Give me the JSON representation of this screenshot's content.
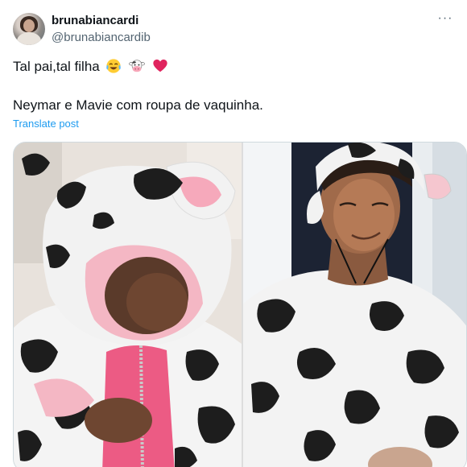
{
  "post": {
    "author": {
      "display_name": "brunabiancardi",
      "handle": "@brunabiancardib",
      "avatar_icon": "profile-photo"
    },
    "more_icon": "more-horizontal-icon",
    "more_glyph": "···",
    "text_line1": "Tal pai,tal filha",
    "text_line1_emojis": [
      "face-with-tears-of-joy-emoji",
      "cow-face-emoji",
      "red-heart-emoji"
    ],
    "text_line2": "Neymar e Mavie com roupa de vaquinha.",
    "translate_label": "Translate post"
  },
  "media": {
    "photos": [
      {
        "subject": "baby-in-cow-costume"
      },
      {
        "subject": "man-in-cow-costume"
      }
    ]
  },
  "colors": {
    "text": "#0f1419",
    "secondary": "#536471",
    "link": "#1d9bf0",
    "border": "#cfd9de",
    "heart": "#e0245e",
    "costume_pink": "#f28aa5"
  }
}
